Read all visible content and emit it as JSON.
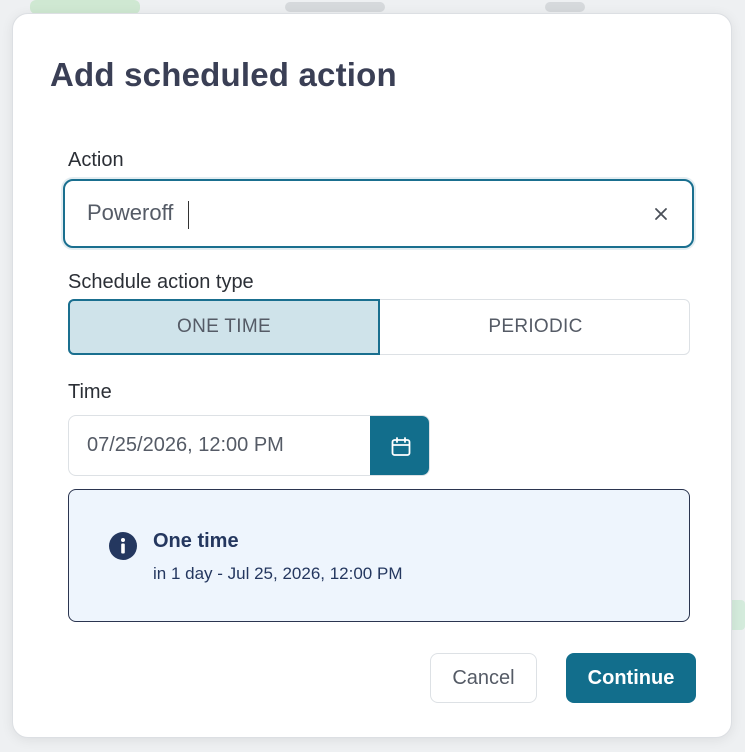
{
  "dialog": {
    "title": "Add scheduled action",
    "action": {
      "label": "Action",
      "value": "Poweroff",
      "clear_icon": "close-icon"
    },
    "schedule_type": {
      "label": "Schedule action type",
      "options": [
        "ONE TIME",
        "PERIODIC"
      ],
      "selected": "ONE TIME"
    },
    "time": {
      "label": "Time",
      "value": "07/25/2026, 12:00 PM",
      "picker_icon": "calendar-icon"
    },
    "info": {
      "icon": "info-icon",
      "title": "One time",
      "description": "in 1 day - Jul 25, 2026, 12:00 PM"
    },
    "buttons": {
      "cancel": "Cancel",
      "continue": "Continue"
    }
  },
  "colors": {
    "primary": "#126e8c",
    "focus_border": "#1a6f8f",
    "selected_bg": "#cfe3ea",
    "info_bg": "#eef5fd",
    "info_text": "#24375f",
    "title_text": "#3a3f55"
  }
}
